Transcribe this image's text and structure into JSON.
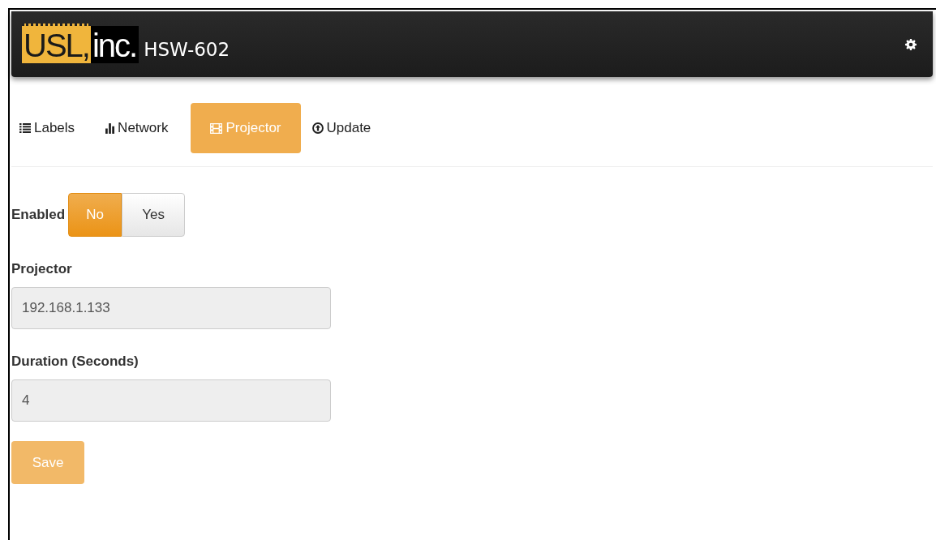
{
  "header": {
    "logo": {
      "left": "USL,",
      "right": "inc."
    },
    "title": "HSW-602"
  },
  "tabs": [
    {
      "label": "Labels",
      "kind": "list",
      "selected": false
    },
    {
      "label": "Network",
      "kind": "chart",
      "selected": false
    },
    {
      "label": "Projector",
      "kind": "film",
      "selected": true
    },
    {
      "label": "Update",
      "kind": "upload",
      "selected": false
    }
  ],
  "enabled": {
    "label": "Enabled",
    "options": [
      {
        "label": "No",
        "selected": true
      },
      {
        "label": "Yes",
        "selected": false
      }
    ]
  },
  "fields": [
    {
      "label": "Projector",
      "value": "192.168.1.133",
      "disabled": true
    },
    {
      "label": "Duration (Seconds)",
      "value": "4",
      "disabled": true
    }
  ],
  "save": {
    "label": "Save",
    "disabled": true
  }
}
